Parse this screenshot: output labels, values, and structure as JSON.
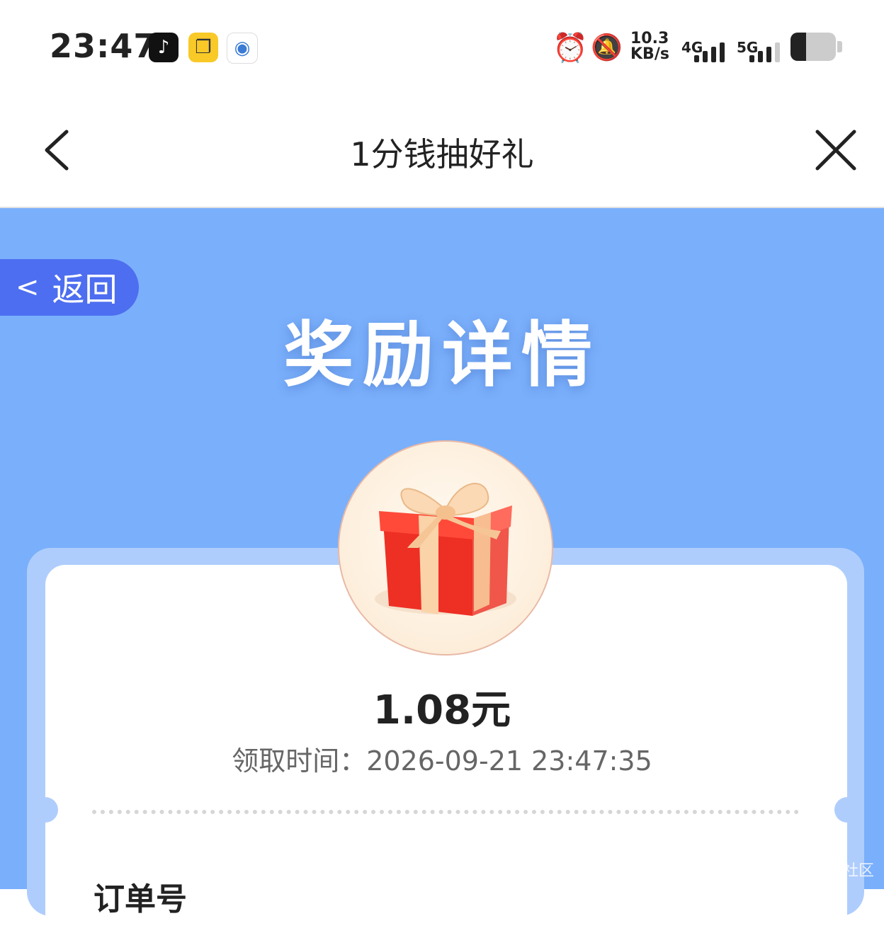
{
  "status_bar": {
    "time": "23:47",
    "app_icons": [
      "tiktok-icon",
      "copy-app-icon",
      "browser-app-icon"
    ],
    "net_speed_value": "10.3",
    "net_speed_unit": "KB/s",
    "network_1": "4G",
    "network_2": "5G",
    "battery_level": 0.35
  },
  "nav": {
    "title": "1分钱抽好礼"
  },
  "page": {
    "back_label": "返回",
    "back_chevron": "<",
    "title": "奖励详情",
    "amount": "1.08元",
    "claim_time": "领取时间：2026-09-21 23:47:35",
    "section_label": "订单号",
    "watermark": "社区"
  },
  "colors": {
    "hero_bg": "#7aaffb",
    "back_pill": "#4d6ef0",
    "card_frame": "#afcdfc"
  }
}
